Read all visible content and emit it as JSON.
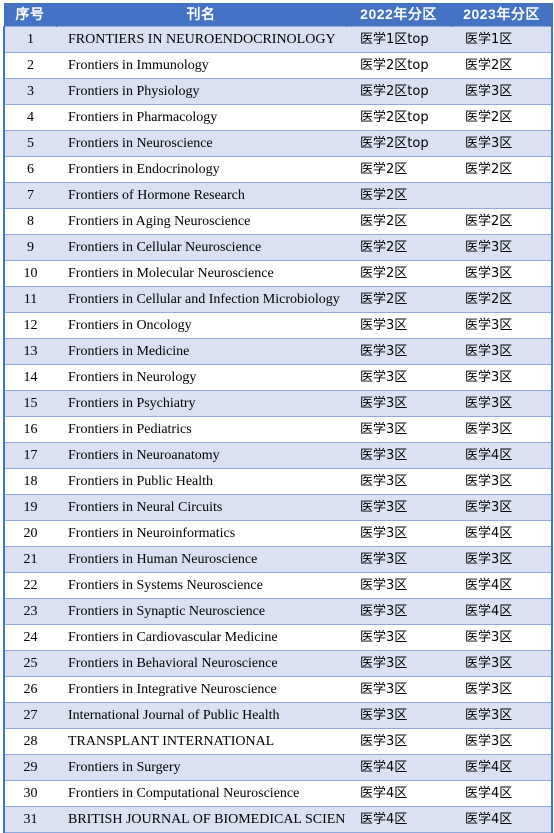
{
  "table": {
    "columns": [
      {
        "key": "index",
        "label": "序号"
      },
      {
        "key": "name",
        "label": "刊名"
      },
      {
        "key": "y2022",
        "label": "2022年分区"
      },
      {
        "key": "y2023",
        "label": "2023年分区"
      }
    ],
    "colors": {
      "header_bg": "#4472C4",
      "header_text": "#FFFFFF",
      "band_bg": "#D9E1F2",
      "alt_bg": "#FFFFFF",
      "rule": "#8FAADC",
      "outer_border": "#4472C4"
    },
    "rows": [
      {
        "index": "1",
        "name": "FRONTIERS IN NEUROENDOCRINOLOGY",
        "y2022": "医学1区top",
        "y2023": "医学1区"
      },
      {
        "index": "2",
        "name": "Frontiers in Immunology",
        "y2022": "医学2区top",
        "y2023": "医学2区"
      },
      {
        "index": "3",
        "name": "Frontiers in Physiology",
        "y2022": "医学2区top",
        "y2023": "医学3区"
      },
      {
        "index": "4",
        "name": "Frontiers in Pharmacology",
        "y2022": "医学2区top",
        "y2023": "医学2区"
      },
      {
        "index": "5",
        "name": "Frontiers in Neuroscience",
        "y2022": "医学2区top",
        "y2023": "医学3区"
      },
      {
        "index": "6",
        "name": "Frontiers in Endocrinology",
        "y2022": "医学2区",
        "y2023": "医学2区"
      },
      {
        "index": "7",
        "name": "Frontiers of Hormone Research",
        "y2022": "医学2区",
        "y2023": ""
      },
      {
        "index": "8",
        "name": "Frontiers in Aging Neuroscience",
        "y2022": "医学2区",
        "y2023": "医学2区"
      },
      {
        "index": "9",
        "name": "Frontiers in Cellular Neuroscience",
        "y2022": "医学2区",
        "y2023": "医学3区"
      },
      {
        "index": "10",
        "name": "Frontiers in Molecular Neuroscience",
        "y2022": "医学2区",
        "y2023": "医学3区"
      },
      {
        "index": "11",
        "name": "Frontiers in Cellular and Infection Microbiology",
        "y2022": "医学2区",
        "y2023": "医学2区"
      },
      {
        "index": "12",
        "name": "Frontiers in Oncology",
        "y2022": "医学3区",
        "y2023": "医学3区"
      },
      {
        "index": "13",
        "name": "Frontiers in Medicine",
        "y2022": "医学3区",
        "y2023": "医学3区"
      },
      {
        "index": "14",
        "name": "Frontiers in Neurology",
        "y2022": "医学3区",
        "y2023": "医学3区"
      },
      {
        "index": "15",
        "name": "Frontiers in Psychiatry",
        "y2022": "医学3区",
        "y2023": "医学3区"
      },
      {
        "index": "16",
        "name": "Frontiers in Pediatrics",
        "y2022": "医学3区",
        "y2023": "医学3区"
      },
      {
        "index": "17",
        "name": "Frontiers in Neuroanatomy",
        "y2022": "医学3区",
        "y2023": "医学4区"
      },
      {
        "index": "18",
        "name": "Frontiers in Public Health",
        "y2022": "医学3区",
        "y2023": "医学3区"
      },
      {
        "index": "19",
        "name": "Frontiers in Neural Circuits",
        "y2022": "医学3区",
        "y2023": "医学3区"
      },
      {
        "index": "20",
        "name": "Frontiers in Neuroinformatics",
        "y2022": "医学3区",
        "y2023": "医学4区"
      },
      {
        "index": "21",
        "name": "Frontiers in Human Neuroscience",
        "y2022": "医学3区",
        "y2023": "医学3区"
      },
      {
        "index": "22",
        "name": "Frontiers in Systems Neuroscience",
        "y2022": "医学3区",
        "y2023": "医学4区"
      },
      {
        "index": "23",
        "name": "Frontiers in Synaptic Neuroscience",
        "y2022": "医学3区",
        "y2023": "医学4区"
      },
      {
        "index": "24",
        "name": "Frontiers in Cardiovascular Medicine",
        "y2022": "医学3区",
        "y2023": "医学3区"
      },
      {
        "index": "25",
        "name": "Frontiers in Behavioral Neuroscience",
        "y2022": "医学3区",
        "y2023": "医学3区"
      },
      {
        "index": "26",
        "name": "Frontiers in Integrative Neuroscience",
        "y2022": "医学3区",
        "y2023": "医学3区"
      },
      {
        "index": "27",
        "name": "International Journal of Public Health",
        "y2022": "医学3区",
        "y2023": "医学3区"
      },
      {
        "index": "28",
        "name": "TRANSPLANT INTERNATIONAL",
        "y2022": "医学3区",
        "y2023": "医学3区"
      },
      {
        "index": "29",
        "name": "Frontiers in Surgery",
        "y2022": "医学4区",
        "y2023": "医学4区"
      },
      {
        "index": "30",
        "name": "Frontiers in Computational Neuroscience",
        "y2022": "医学4区",
        "y2023": "医学4区"
      },
      {
        "index": "31",
        "name": "BRITISH JOURNAL OF BIOMEDICAL SCIENCES",
        "y2022": "医学4区",
        "y2023": "医学4区"
      }
    ]
  }
}
